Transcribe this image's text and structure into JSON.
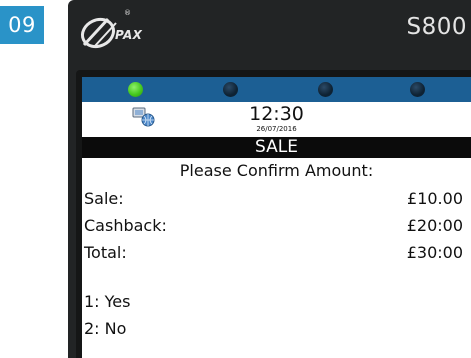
{
  "step_number": "09",
  "device": {
    "brand": "PAX",
    "brand_mark": "®",
    "model": "S800"
  },
  "status": {
    "leds": [
      {
        "name": "led-1",
        "color": "#45c81f",
        "state": "on"
      },
      {
        "name": "led-2",
        "color": "#0e2233",
        "state": "off"
      },
      {
        "name": "led-3",
        "color": "#0e2233",
        "state": "off"
      },
      {
        "name": "led-4",
        "color": "#0e2233",
        "state": "off"
      }
    ],
    "icon": "network-globe-icon"
  },
  "clock": {
    "time": "12:30",
    "date": "26/07/2016"
  },
  "screen": {
    "title": "SALE",
    "prompt": "Please Confirm Amount:",
    "amounts": [
      {
        "label": "Sale:",
        "value": "£10.00"
      },
      {
        "label": "Cashback:",
        "value": "£20:00"
      },
      {
        "label": "Total:",
        "value": "£30:00"
      }
    ],
    "options": [
      {
        "label": "1: Yes"
      },
      {
        "label": "2: No"
      }
    ]
  },
  "colors": {
    "step_badge": "#2a93c8",
    "terminal_body": "#222425",
    "status_bar": "#1c5f94",
    "title_bar": "#0b0b0b"
  }
}
